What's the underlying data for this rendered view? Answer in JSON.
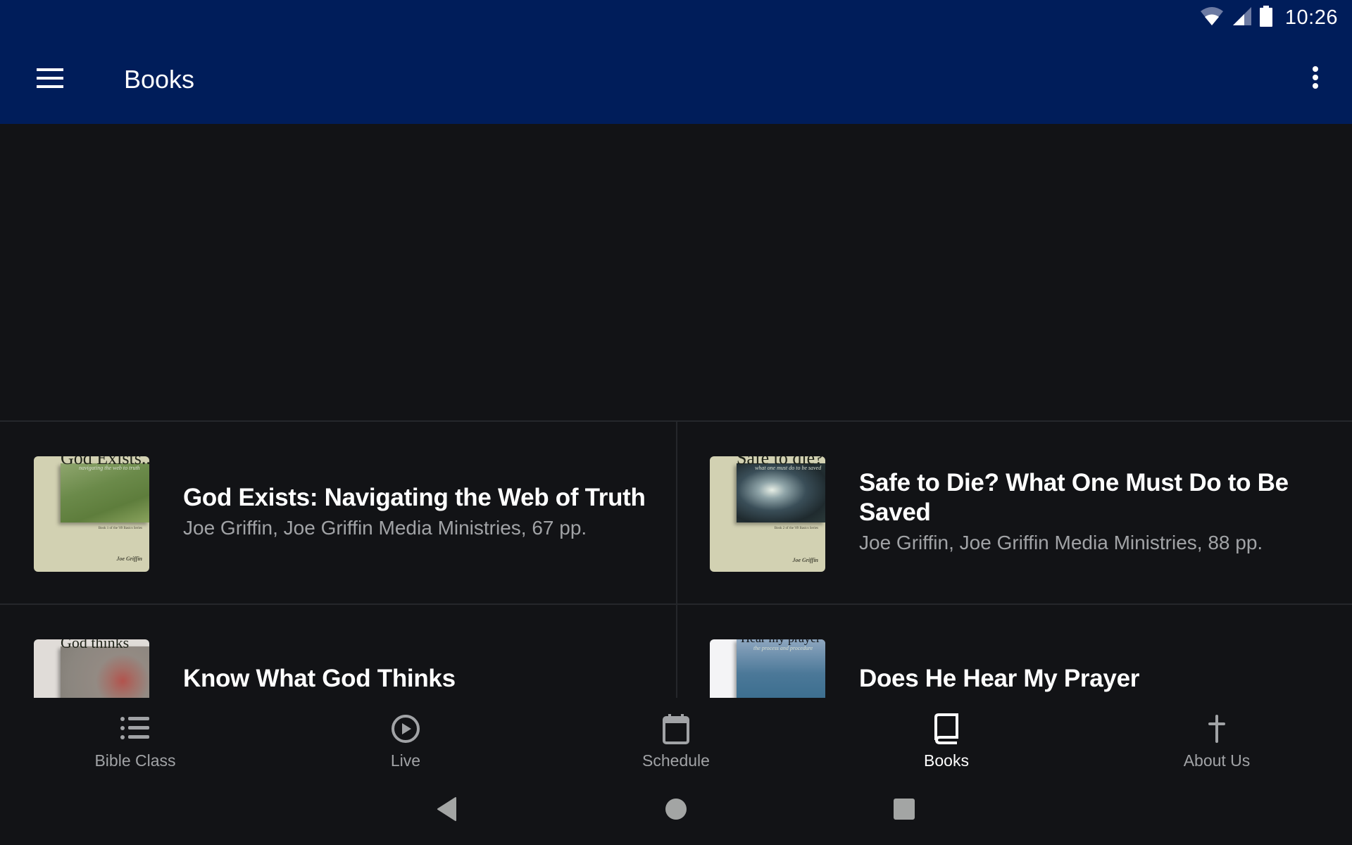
{
  "status_bar": {
    "time": "10:26",
    "icons": [
      "wifi-icon",
      "cell-signal-icon",
      "battery-icon"
    ]
  },
  "toolbar": {
    "title": "Books",
    "menu_icon": "hamburger-menu-icon",
    "overflow_icon": "more-vert-icon"
  },
  "books": [
    {
      "title": "God Exists: Navigating the Web of Truth",
      "meta": "Joe Griffin, Joe Griffin Media Ministries, 67 pp.",
      "cover": {
        "title": "God Exists...",
        "subtitle": "navigating the web to truth",
        "series": "Book 1 of the '89 Basics Series",
        "author": "Joe Griffin"
      }
    },
    {
      "title": "Safe to Die? What One Must Do to Be Saved",
      "meta": "Joe Griffin, Joe Griffin Media Ministries, 88 pp.",
      "cover": {
        "title": "Safe to die?",
        "subtitle": "what one must do to be saved",
        "series": "Book 2 of the '89 Basics Series",
        "author": "Joe Griffin"
      }
    },
    {
      "title": "Know What God Thinks",
      "meta": "",
      "cover": {
        "title": "God thinks",
        "subtitle": ""
      }
    },
    {
      "title": "Does He Hear My Prayer",
      "meta": "",
      "cover": {
        "title": "Hear my prayer",
        "subtitle": "the process and procedure"
      }
    }
  ],
  "bottom_nav": {
    "items": [
      {
        "label": "Bible Class",
        "icon": "list-icon",
        "active": false
      },
      {
        "label": "Live",
        "icon": "play-circle-icon",
        "active": false
      },
      {
        "label": "Schedule",
        "icon": "calendar-icon",
        "active": false
      },
      {
        "label": "Books",
        "icon": "book-icon",
        "active": true
      },
      {
        "label": "About Us",
        "icon": "cross-icon",
        "active": false
      }
    ]
  },
  "system_nav": [
    "back-icon",
    "home-icon",
    "recents-icon"
  ],
  "colors": {
    "appbar": "#001d5a",
    "background": "#121316",
    "divider": "#25272b",
    "secondary_text": "#a1a3a6",
    "active_nav": "#ffffff"
  }
}
